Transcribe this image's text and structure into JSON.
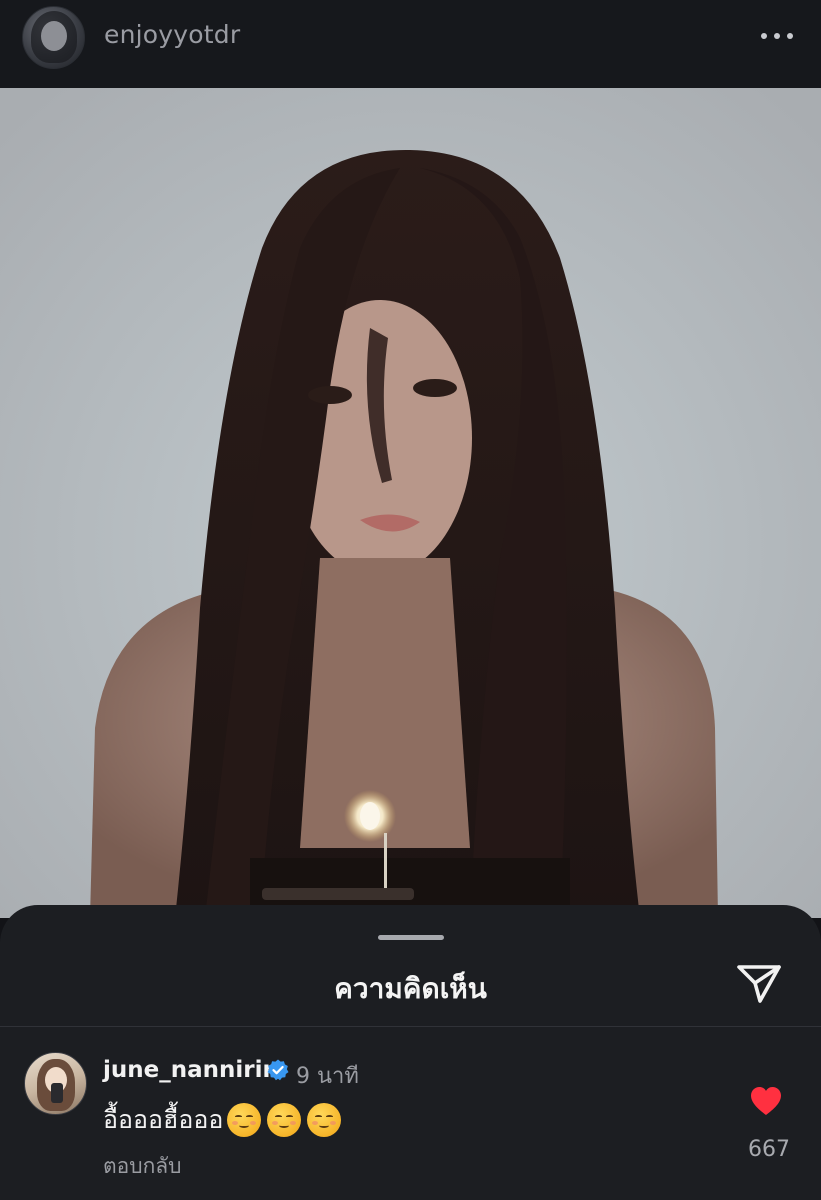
{
  "post": {
    "username": "enjoyyotdr",
    "avatar_icon": "profile-avatar",
    "more_icon": "more-horizontal-icon"
  },
  "comments_sheet": {
    "title": "ความคิดเห็น",
    "share_icon": "paper-plane-icon"
  },
  "comment": {
    "username": "june_nannirin",
    "verified_icon": "verified-badge-icon",
    "verified_color": "#3897f0",
    "time": "9 นาที",
    "text": "อื้อออฮื้อออ",
    "emoji_icon": "smiling-face-icon",
    "emoji_count": 3,
    "reply_label": "ตอบกลับ",
    "like_icon": "heart-icon",
    "like_color": "#ff3040",
    "liked": true,
    "like_count": "667"
  }
}
